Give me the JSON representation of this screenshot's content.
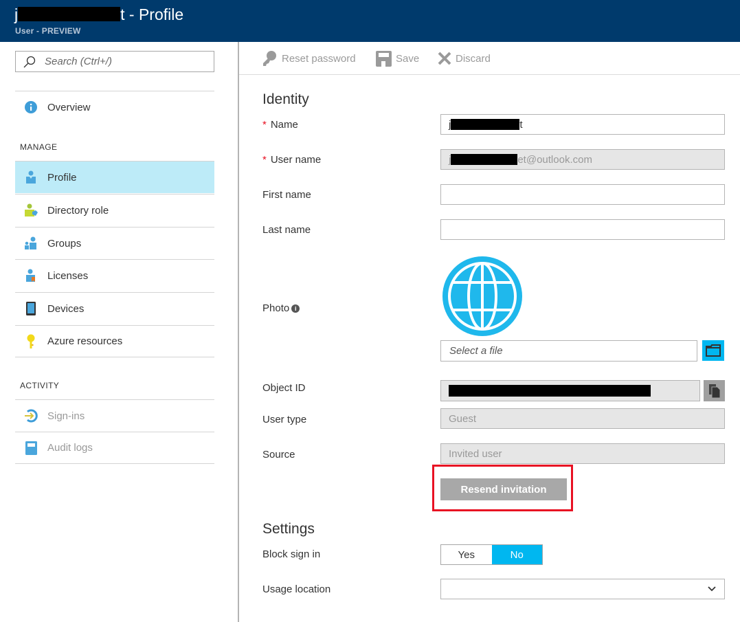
{
  "header": {
    "title_prefix": "j",
    "title_suffix": "t - Profile",
    "subtitle": "User - PREVIEW"
  },
  "sidebar": {
    "search_placeholder": "Search (Ctrl+/)",
    "overview": {
      "label": "Overview",
      "icon": "info-icon"
    },
    "manage_label": "MANAGE",
    "manage_items": [
      {
        "label": "Profile",
        "icon": "profile-icon",
        "active": true
      },
      {
        "label": "Directory role",
        "icon": "directory-role-icon"
      },
      {
        "label": "Groups",
        "icon": "groups-icon"
      },
      {
        "label": "Licenses",
        "icon": "licenses-icon"
      },
      {
        "label": "Devices",
        "icon": "devices-icon"
      },
      {
        "label": "Azure resources",
        "icon": "key-icon"
      }
    ],
    "activity_label": "ACTIVITY",
    "activity_items": [
      {
        "label": "Sign-ins",
        "icon": "sign-in-icon",
        "disabled": true
      },
      {
        "label": "Audit logs",
        "icon": "audit-log-icon",
        "disabled": true
      }
    ]
  },
  "toolbar": {
    "reset_password": "Reset password",
    "save": "Save",
    "discard": "Discard"
  },
  "identity": {
    "title": "Identity",
    "name_label": "Name",
    "name_value_prefix": "j",
    "name_value_suffix": "t",
    "username_label": "User name",
    "username_value_prefix": "j",
    "username_value_suffix": "et@outlook.com",
    "first_name_label": "First name",
    "first_name_value": "",
    "last_name_label": "Last name",
    "last_name_value": "",
    "photo_label": "Photo",
    "file_placeholder": "Select a file",
    "object_id_label": "Object ID",
    "user_type_label": "User type",
    "user_type_value": "Guest",
    "source_label": "Source",
    "source_value": "Invited user",
    "resend_label": "Resend invitation"
  },
  "settings": {
    "title": "Settings",
    "block_signin_label": "Block sign in",
    "block_options": [
      "Yes",
      "No"
    ],
    "block_selected": "No",
    "usage_location_label": "Usage location",
    "usage_location_value": ""
  },
  "colors": {
    "header_bg": "#003a6c",
    "accent": "#00b7f0",
    "active_nav": "#bdebf8",
    "highlight_box": "#e81123"
  }
}
